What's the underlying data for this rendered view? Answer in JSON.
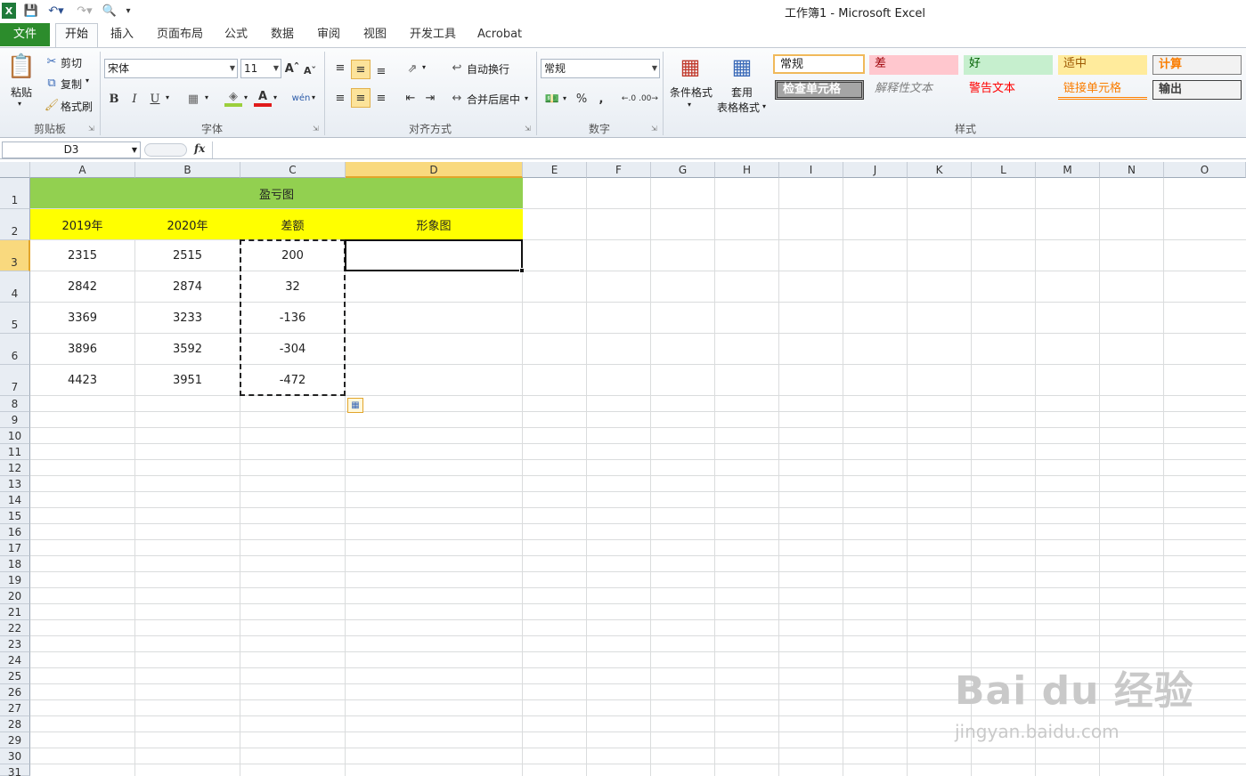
{
  "window": {
    "title": "工作簿1 - Microsoft Excel"
  },
  "tabs": {
    "file": "文件",
    "home": "开始",
    "items": [
      "插入",
      "页面布局",
      "公式",
      "数据",
      "审阅",
      "视图",
      "开发工具",
      "Acrobat"
    ]
  },
  "clipboard": {
    "paste": "粘贴",
    "cut": "剪切",
    "copy": "复制",
    "format_painter": "格式刷",
    "group": "剪贴板"
  },
  "font": {
    "name": "宋体",
    "size": "11",
    "group": "字体",
    "bold": "B",
    "italic": "I",
    "underline": "U"
  },
  "alignment": {
    "wrap": "自动换行",
    "merge": "合并后居中",
    "group": "对齐方式"
  },
  "number": {
    "format": "常规",
    "percent": "%",
    "comma": ",",
    "group": "数字"
  },
  "styles": {
    "cond_format": "条件格式",
    "table_format_1": "套用",
    "table_format_2": "表格格式",
    "group": "样式",
    "boxes": [
      "常规",
      "差",
      "好",
      "适中",
      "计算",
      "检查单元格",
      "解释性文本",
      "警告文本",
      "链接单元格",
      "输出"
    ]
  },
  "formula_bar": {
    "name_box": "D3",
    "fx": "fx",
    "value": ""
  },
  "columns": [
    "A",
    "B",
    "C",
    "D",
    "E",
    "F",
    "G",
    "H",
    "I",
    "J",
    "K",
    "L",
    "M",
    "N",
    "O"
  ],
  "rows": [
    "1",
    "2",
    "3",
    "4",
    "5",
    "6",
    "7",
    "8",
    "9",
    "10",
    "11",
    "12",
    "13",
    "14",
    "15",
    "16",
    "17",
    "18",
    "19",
    "20",
    "21",
    "22",
    "23",
    "24",
    "25",
    "26",
    "27",
    "28",
    "29",
    "30",
    "31"
  ],
  "sheet": {
    "title": "盈亏图",
    "headers": [
      "2019年",
      "2020年",
      "差额",
      "形象图"
    ],
    "data": [
      [
        "2315",
        "2515",
        "200"
      ],
      [
        "2842",
        "2874",
        "32"
      ],
      [
        "3369",
        "3233",
        "-136"
      ],
      [
        "3896",
        "3592",
        "-304"
      ],
      [
        "4423",
        "3951",
        "-472"
      ]
    ]
  },
  "colors": {
    "title_fill": "#92d050",
    "header_fill": "#ffff00",
    "file_tab": "#2c8c2c"
  },
  "watermark": {
    "brand": "Bai du 经验",
    "url": "jingyan.baidu.com"
  }
}
